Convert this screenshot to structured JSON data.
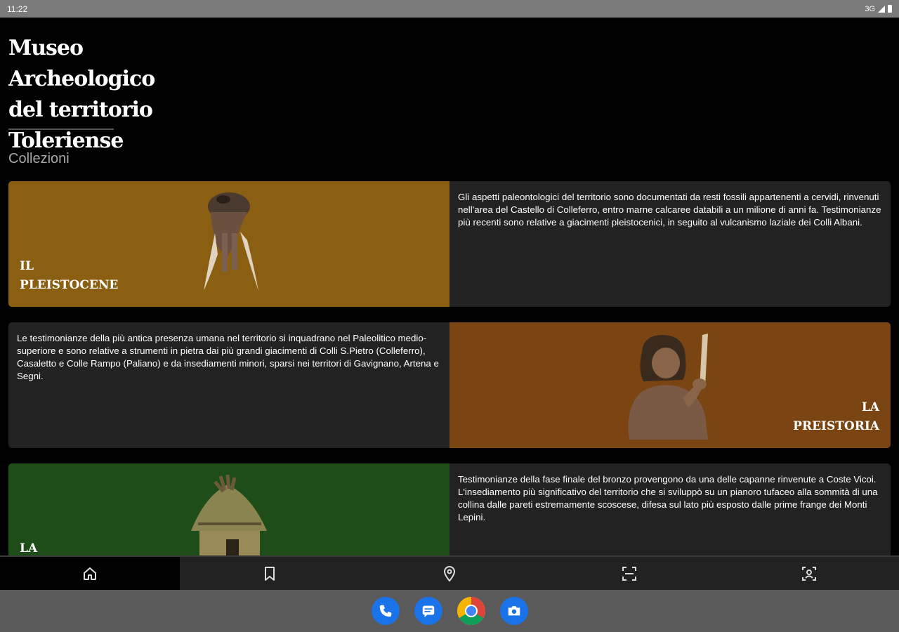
{
  "status_bar": {
    "time": "11:22",
    "network": "3G"
  },
  "header": {
    "title_lines": [
      "Museo Archeologico",
      "del territorio",
      "Toleriense"
    ]
  },
  "section_title": "Collezioni",
  "collections": [
    {
      "label_lines": [
        "IL",
        "PLEISTOCENE"
      ],
      "description": "Gli aspetti paleontologici del territorio sono documentati da resti fossili appartenenti a cervidi, rinvenuti nell'area del Castello di Colleferro, entro marne calcaree databili a un milione di anni fa. Testimonianze più recenti sono relative a giacimenti pleistocenici, in seguito al vulcanismo laziale dei Colli Albani.",
      "color": "#8B5F12"
    },
    {
      "label_lines": [
        "LA",
        "PREISTORIA"
      ],
      "description": "Le testimonianze della più antica presenza umana nel territorio si inquadrano nel Paleolitico medio-superiore e sono relative a strumenti in pietra dai più grandi giacimenti di Colli S.Pietro (Colleferro), Casaletto e Colle Rampo (Paliano) e da insediamenti minori, sparsi nei territori di Gavignano, Artena e Segni.",
      "color": "#7A4512"
    },
    {
      "label_lines": [
        "LA",
        ""
      ],
      "description": "Testimonianze della fase finale del bronzo provengono da una delle capanne rinvenute a Coste Vicoi. L'insediamento più significativo del territorio che si sviluppò su un pianoro tufaceo alla sommità di una collina dalle pareti estremamente scoscese, difesa sul lato più esposto dalle prime frange dei Monti Lepini.",
      "color": "#1F4D1A"
    }
  ],
  "bottom_nav": [
    {
      "icon": "home-icon",
      "active": true
    },
    {
      "icon": "bookmark-icon",
      "active": false
    },
    {
      "icon": "location-pin-icon",
      "active": false
    },
    {
      "icon": "scan-frame-icon",
      "active": false
    },
    {
      "icon": "face-scan-icon",
      "active": false
    }
  ],
  "dock": [
    {
      "icon": "phone-icon",
      "color": "#1a73e8"
    },
    {
      "icon": "messages-icon",
      "color": "#1a73e8"
    },
    {
      "icon": "chrome-icon",
      "color": "#ffffff"
    },
    {
      "icon": "camera-icon",
      "color": "#1a73e8"
    }
  ]
}
